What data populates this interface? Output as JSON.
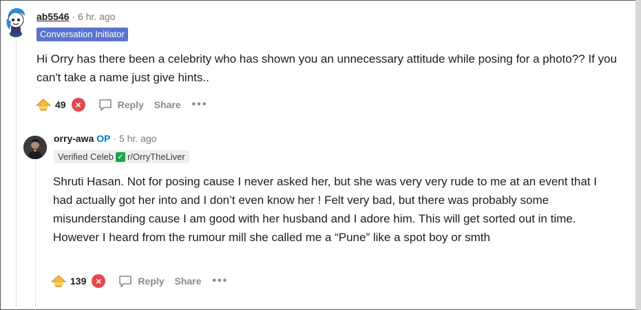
{
  "comment1": {
    "username": "ab5546",
    "timestamp": "6 hr. ago",
    "flair": "Conversation Initiator",
    "body": "Hi Orry has there been a celebrity who has shown you an unnecessary attitude while posing for a photo?? If you can't take a name just give hints..",
    "score": "49",
    "reply_label": "Reply",
    "share_label": "Share",
    "more_label": "•••"
  },
  "comment2": {
    "username": "orry-awa",
    "op_label": "OP",
    "timestamp": "5 hr. ago",
    "flair_verified": "Verified Celeb",
    "flair_check": "✓",
    "flair_sub": "r/OrryTheLiver",
    "body": "Shruti Hasan. Not for posing cause I never asked her, but she was very very rude to me at an event that I had actually got her into and I don’t even know her ! Felt very bad, but there was probably some misunderstanding cause I am good with her husband and I adore him. This will get sorted out in time. However I heard from the rumour mill she called me a “Pune” like a spot boy or smth",
    "score": "139",
    "reply_label": "Reply",
    "share_label": "Share",
    "more_label": "•••"
  },
  "icons": {
    "upvote": "award-upvote-icon",
    "downvote": "downvote-x-icon",
    "reply": "speech-bubble-icon",
    "more": "ellipsis-icon"
  },
  "colors": {
    "initiator_flair": "#5a74cc",
    "op": "#0079d3",
    "downvote": "#e5484d",
    "verified_check": "#1ea34b"
  }
}
